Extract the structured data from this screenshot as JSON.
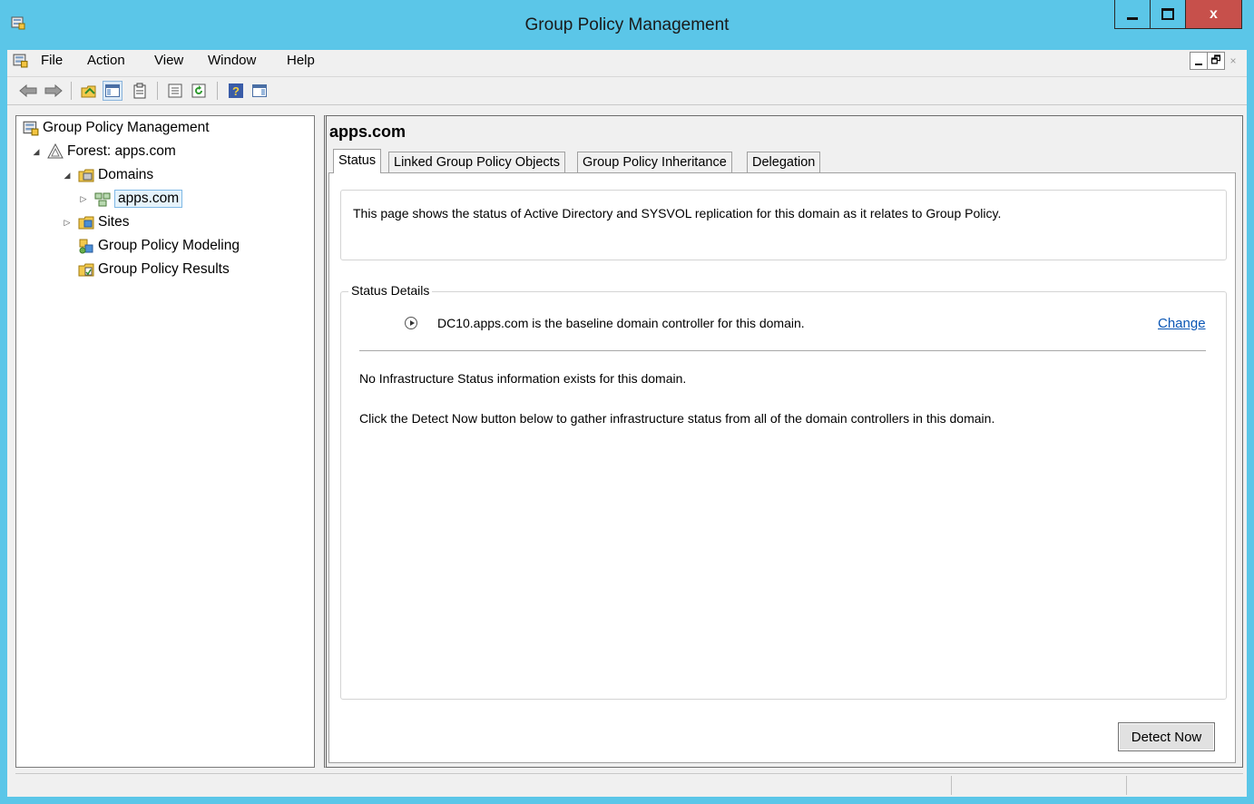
{
  "window": {
    "title": "Group Policy Management",
    "close_glyph": "x"
  },
  "menu": [
    "File",
    "Action",
    "View",
    "Window",
    "Help"
  ],
  "mdi": {
    "restore_glyph": "🗗",
    "close_glyph": "×"
  },
  "toolbar": [
    "back-arrow-icon",
    "forward-arrow-icon",
    "up-folder-icon",
    "show-hide-tree-icon",
    "clipboard-icon",
    "properties-icon",
    "refresh-icon",
    "help-icon",
    "action-pane-icon"
  ],
  "tree": {
    "root": "Group Policy Management",
    "forest": "Forest: apps.com",
    "domains": "Domains",
    "domain": "apps.com",
    "sites": "Sites",
    "modeling": "Group Policy Modeling",
    "results": "Group Policy Results"
  },
  "main": {
    "title": "apps.com",
    "tabs": [
      "Status",
      "Linked Group Policy Objects",
      "Group Policy Inheritance",
      "Delegation"
    ],
    "info": "This page shows the status of Active Directory and SYSVOL replication for this domain as it relates to Group Policy.",
    "details_title": "Status Details",
    "baseline": "DC10.apps.com is the baseline domain controller for this domain.",
    "change": "Change",
    "no_info": "No Infrastructure Status information exists for this domain.",
    "instructions": "Click the Detect Now button below to gather infrastructure status from all of the domain controllers in this domain.",
    "detect_button": "Detect Now"
  },
  "colors": {
    "titlebar": "#5bc6e8",
    "close": "#c7504b",
    "link": "#0a56b5"
  }
}
